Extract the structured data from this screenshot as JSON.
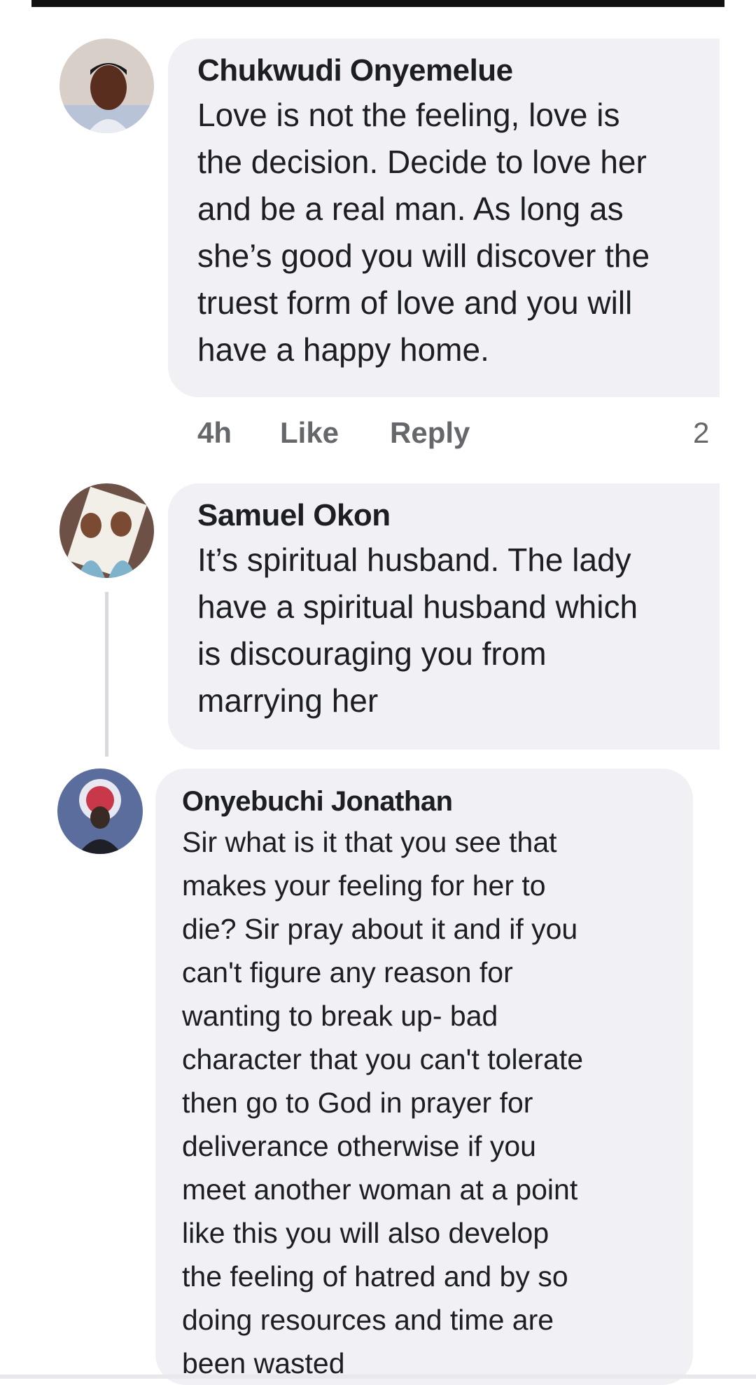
{
  "comments": [
    {
      "author": "Chukwudi Onyemelue",
      "lines": [
        "Love is not the feeling, love is",
        "the decision. Decide to love her",
        "and be a real man. As long as",
        "she’s good you will discover the",
        "truest form of love and you will",
        "have a happy home."
      ],
      "time": "4h",
      "like_label": "Like",
      "reply_label": "Reply",
      "reaction_count": "2"
    },
    {
      "author": "Samuel Okon",
      "lines": [
        "It’s spiritual husband. The lady",
        "have a spiritual husband which",
        "is discouraging you from",
        "marrying her"
      ]
    },
    {
      "author": "Onyebuchi Jonathan",
      "lines": [
        "Sir what is it that you see that",
        "makes your feeling for her to",
        "die? Sir pray about it and if you",
        "can't figure any reason for",
        "wanting to break up- bad",
        "character that you can't tolerate",
        "then go to God in prayer for",
        "deliverance otherwise if you",
        "meet another woman at a point",
        "like this you will also develop",
        "the feeling of hatred and by so",
        "doing resources and time are",
        "been wasted"
      ]
    }
  ],
  "colors": {
    "bubble": "#f0f0f5",
    "meta_text": "#65676b",
    "thread_line": "#d8d8dd"
  }
}
